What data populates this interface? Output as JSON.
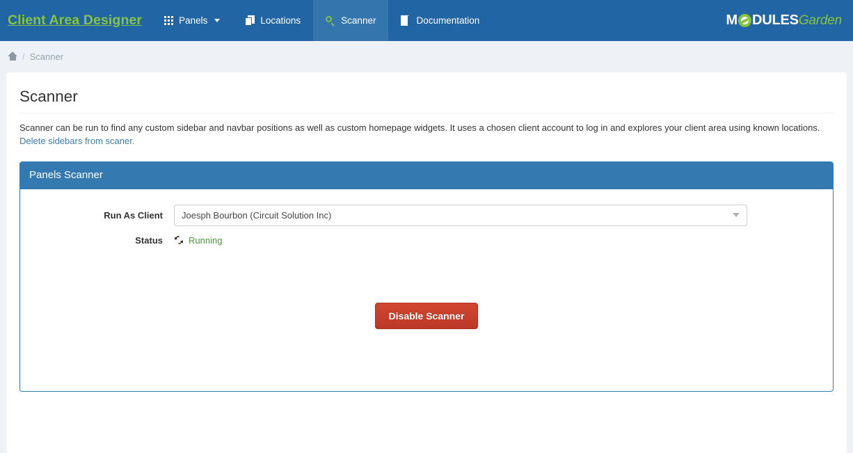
{
  "navbar": {
    "brand": "Client Area Designer",
    "items": [
      {
        "label": "Panels",
        "icon": "grid-icon",
        "active": false,
        "has_caret": true
      },
      {
        "label": "Locations",
        "icon": "clone-icon",
        "active": false,
        "has_caret": false
      },
      {
        "label": "Scanner",
        "icon": "search-icon",
        "active": true,
        "has_caret": false
      },
      {
        "label": "Documentation",
        "icon": "book-icon",
        "active": false,
        "has_caret": false
      }
    ],
    "logo": {
      "part1": "M",
      "part2": "DULES",
      "part3": "Garden"
    },
    "colors": {
      "bar_bg": "#2265a4",
      "active_bg": "#3475ad",
      "brand_green": "#86c440"
    }
  },
  "breadcrumb": {
    "home_icon": "home-icon",
    "separator": "/",
    "current": "Scanner"
  },
  "page": {
    "title": "Scanner",
    "description": "Scanner can be run to find any custom sidebar and navbar positions as well as custom homepage widgets. It uses a chosen client account to log in and explores your client area using known locations.",
    "delete_link": "Delete sidebars from scaner."
  },
  "panel": {
    "title": "Panels Scanner",
    "header_color": "#3479b0",
    "fields": {
      "run_as_client_label": "Run As Client",
      "run_as_client_value": "Joesph Bourbon (Circuit Solution Inc)",
      "status_label": "Status",
      "status_value": "Running",
      "status_color": "#4c9a3c",
      "status_icon": "refresh-icon"
    },
    "action_button": {
      "label": "Disable Scanner",
      "color": "#c63d29"
    }
  }
}
